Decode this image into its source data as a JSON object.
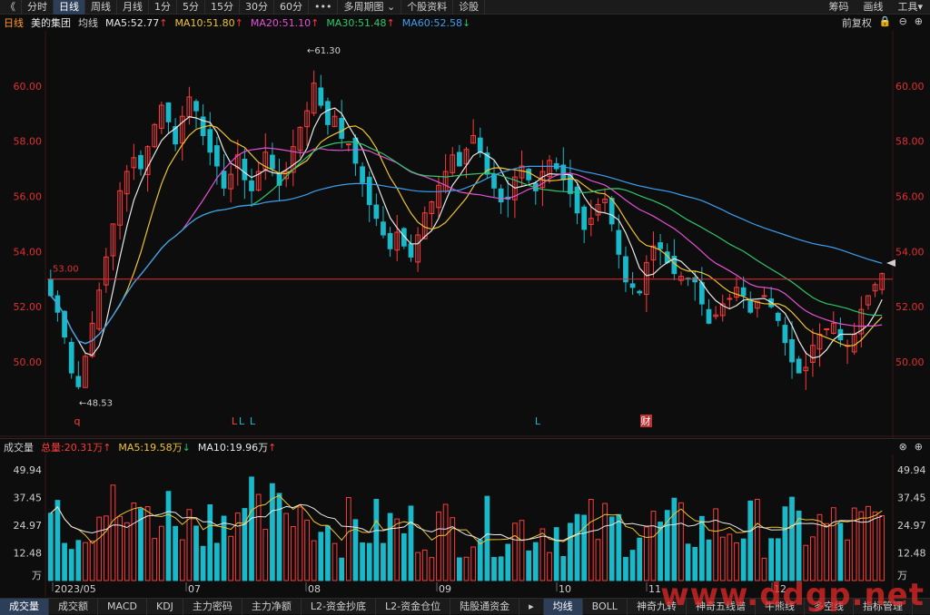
{
  "toolbar": {
    "back": "《",
    "items": [
      "分时",
      "日线",
      "周线",
      "月线",
      "1分",
      "5分",
      "15分",
      "30分",
      "60分",
      "•••",
      "多周期图 ⌄",
      "个股资料",
      "诊股"
    ],
    "active_index": 1,
    "right": [
      "筹码",
      "画线",
      "工具▾"
    ]
  },
  "info": {
    "period": "日线",
    "stock": "美的集团",
    "ma_label": "均线",
    "ma5": "MA5:52.77",
    "ma10": "MA10:51.80",
    "ma20": "MA20:51.10",
    "ma30": "MA30:51.48",
    "ma60": "MA60:52.58",
    "fq": "前复权"
  },
  "price_axis": {
    "ticks": [
      "60.00",
      "58.00",
      "56.00",
      "54.00",
      "52.00",
      "50.00"
    ],
    "ref_label": "53.00",
    "high_label": "61.30",
    "low_label": "48.53"
  },
  "markers": [
    "q",
    "L",
    "L",
    "L",
    "L",
    "财"
  ],
  "volume": {
    "title": "成交量",
    "total": "总量:20.31万",
    "ma5": "MA5:19.58万",
    "ma10": "MA10:19.96万",
    "ticks": [
      "49.94",
      "37.45",
      "24.97",
      "12.48",
      "万"
    ]
  },
  "dates": [
    "2023/05",
    "07",
    "08",
    "09",
    "10",
    "11",
    "12"
  ],
  "bottom_tabs": [
    "成交量",
    "成交额",
    "MACD",
    "KDJ",
    "主力密码",
    "主力净额",
    "L2-资金抄底",
    "L2-资金仓位",
    "陆股通资金",
    "▸",
    "均线",
    "BOLL",
    "神奇九转",
    "神奇五线谱",
    "牛熊线",
    "多空线",
    "指标管理"
  ],
  "bottom_active": [
    0,
    10
  ],
  "watermark": "www.ddgp.net",
  "colors": {
    "up": "#ff3b3b",
    "down": "#19b9c9",
    "ma5": "#e8e8e8",
    "ma10": "#f0c330",
    "ma20": "#e451d6",
    "ma30": "#2fc66b",
    "ma60": "#3d9ef0",
    "ref": "#e03030"
  },
  "chart_data": {
    "type": "candlestick",
    "symbol": "美的集团",
    "closes": [
      52.4,
      51.8,
      50.9,
      49.6,
      49.1,
      50.2,
      51.4,
      52.6,
      53.8,
      55.0,
      56.2,
      56.9,
      57.4,
      57.0,
      57.8,
      58.6,
      59.3,
      58.7,
      57.9,
      58.9,
      59.6,
      59.1,
      58.2,
      57.6,
      57.1,
      56.3,
      56.8,
      57.5,
      56.6,
      56.2,
      56.9,
      57.6,
      57.0,
      56.4,
      56.9,
      57.8,
      58.5,
      59.1,
      60.1,
      59.3,
      58.6,
      58.9,
      58.1,
      57.9,
      57.2,
      56.5,
      55.7,
      55.2,
      54.6,
      54.1,
      54.7,
      54.2,
      53.8,
      54.6,
      55.4,
      55.8,
      56.4,
      56.9,
      57.5,
      57.1,
      57.7,
      58.2,
      57.6,
      56.8,
      56.3,
      55.8,
      55.9,
      56.7,
      57.1,
      56.6,
      56.2,
      56.9,
      57.3,
      57.0,
      56.6,
      56.1,
      55.4,
      54.8,
      55.2,
      55.7,
      55.9,
      55.0,
      53.9,
      52.9,
      52.7,
      52.5,
      53.6,
      54.2,
      54.1,
      53.6,
      53.2,
      53.1,
      53.0,
      52.9,
      52.1,
      51.4,
      51.7,
      52.1,
      52.3,
      52.7,
      52.4,
      51.8,
      52.2,
      52.4,
      52.0,
      51.5,
      50.7,
      50.0,
      49.6,
      49.8,
      50.6,
      51.0,
      51.2,
      51.4,
      50.8,
      50.6,
      51.0,
      51.9,
      52.4,
      52.8,
      53.2
    ],
    "ylim": [
      47.5,
      61.8
    ],
    "high": 61.3,
    "low": 48.53,
    "reference_price": 53.0,
    "volume_ticks": [
      49.94,
      37.45,
      24.97,
      12.48
    ],
    "volume_unit": "万"
  }
}
